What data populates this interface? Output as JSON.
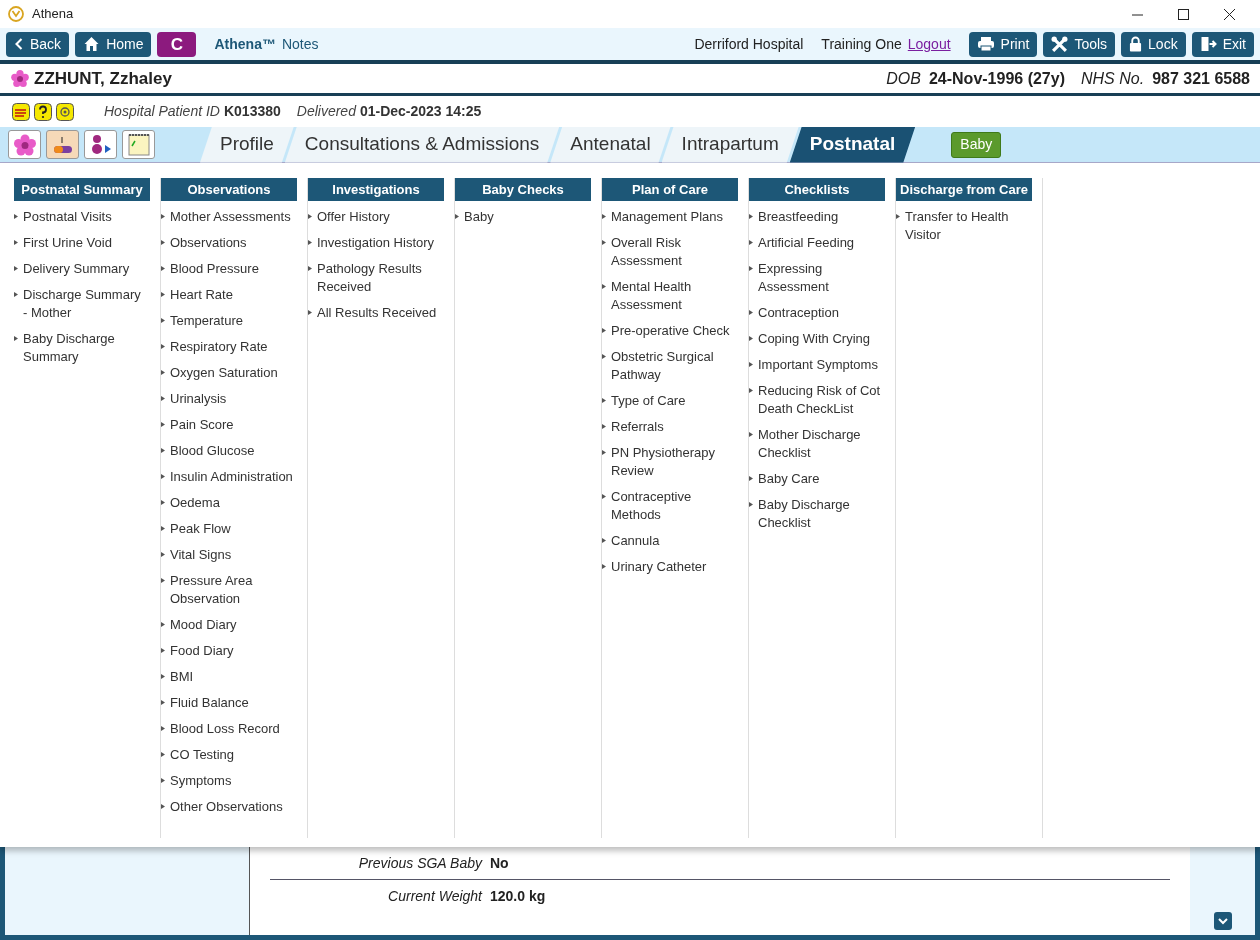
{
  "window": {
    "title": "Athena"
  },
  "toolbar": {
    "left_buttons": [
      {
        "label": "Back",
        "kind": "back"
      },
      {
        "label": "Home",
        "kind": "home"
      }
    ],
    "c_button": "C",
    "app_name": "Athena™",
    "app_section": "Notes",
    "hospital": "Derriford Hospital",
    "user": "Training One",
    "logout": "Logout",
    "right_buttons": [
      {
        "label": "Print",
        "kind": "print"
      },
      {
        "label": "Tools",
        "kind": "tools"
      },
      {
        "label": "Lock",
        "kind": "lock"
      },
      {
        "label": "Exit",
        "kind": "exit"
      }
    ]
  },
  "patient": {
    "name": "ZZHUNT, Zzhaley",
    "dob_label": "DOB",
    "dob": "24-Nov-1996 (27y)",
    "nhs_label": "NHS No.",
    "nhs": "987 321 6588"
  },
  "info": {
    "id_label": "Hospital Patient ID",
    "id": "K013380",
    "delivered_label": "Delivered",
    "delivered": "01-Dec-2023 14:25"
  },
  "tabs": [
    {
      "label": "Profile",
      "selected": false
    },
    {
      "label": "Consultations & Admissions",
      "selected": false
    },
    {
      "label": "Antenatal",
      "selected": false
    },
    {
      "label": "Intrapartum",
      "selected": false
    },
    {
      "label": "Postnatal",
      "selected": true
    }
  ],
  "baby_button": "Baby",
  "menu_columns": [
    {
      "heading": "Postnatal Summary",
      "items": [
        "Postnatal Visits",
        "First Urine Void",
        "Delivery Summary",
        "Discharge Summary - Mother",
        "Baby Discharge Summary"
      ]
    },
    {
      "heading": "Observations",
      "items": [
        "Mother Assessments",
        "Observations",
        "Blood Pressure",
        "Heart Rate",
        "Temperature",
        "Respiratory Rate",
        "Oxygen Saturation",
        "Urinalysis",
        "Pain Score",
        "Blood Glucose",
        "Insulin Administration",
        "Oedema",
        "Peak Flow",
        "Vital Signs",
        "Pressure Area Observation",
        "Mood Diary",
        "Food Diary",
        "BMI",
        "Fluid Balance",
        "Blood Loss Record",
        "CO Testing",
        "Symptoms",
        "Other Observations"
      ]
    },
    {
      "heading": "Investigations",
      "items": [
        "Offer History",
        "Investigation History",
        "Pathology Results Received",
        "All Results Received"
      ]
    },
    {
      "heading": "Baby Checks",
      "items": [
        "Baby"
      ]
    },
    {
      "heading": "Plan of Care",
      "items": [
        "Management Plans",
        "Overall Risk Assessment",
        "Mental Health Assessment",
        "Pre-operative Check",
        "Obstetric Surgical Pathway",
        "Type of Care",
        "Referrals",
        "PN Physiotherapy Review",
        "Contraceptive Methods",
        "Cannula",
        "Urinary Catheter"
      ]
    },
    {
      "heading": "Checklists",
      "items": [
        "Breastfeeding",
        "Artificial Feeding",
        "Expressing Assessment",
        "Contraception",
        "Coping With Crying",
        "Important Symptoms",
        "Reducing Risk of Cot Death CheckList",
        "Mother Discharge Checklist",
        "Baby Care",
        "Baby Discharge Checklist"
      ]
    },
    {
      "heading": "Discharge from Care",
      "items": [
        "Transfer to Health Visitor"
      ]
    }
  ],
  "form_rows": [
    {
      "label": "Previous SGA Baby",
      "value": "No"
    },
    {
      "label": "Current Weight",
      "value": "120.0 kg"
    }
  ]
}
